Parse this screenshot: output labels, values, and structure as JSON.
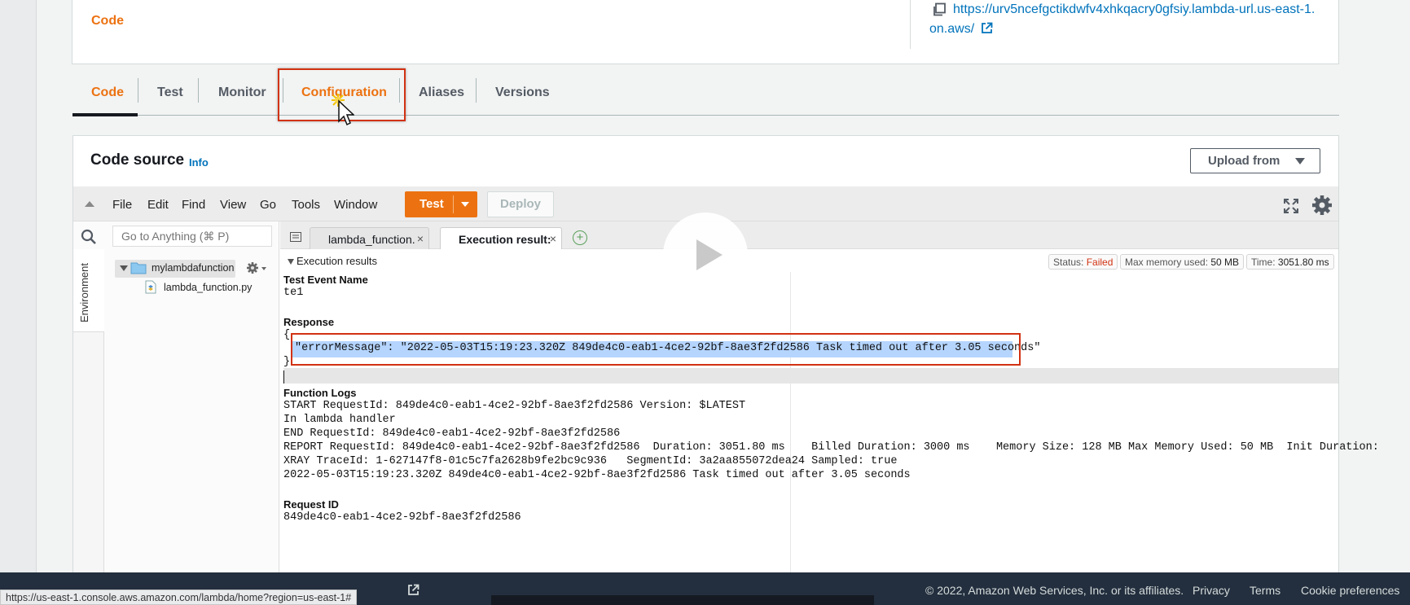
{
  "function_url": {
    "line1": "https://urv5ncefgctikdwfv4xhkqacry0gfsiy.lambda-url.us-east-1.",
    "line2": "on.aws/"
  },
  "tabs": [
    {
      "label": "Code",
      "active": true
    },
    {
      "label": "Test"
    },
    {
      "label": "Monitor"
    },
    {
      "label": "Configuration",
      "highlighted": true
    },
    {
      "label": "Aliases"
    },
    {
      "label": "Versions"
    }
  ],
  "code_source": {
    "title": "Code source",
    "info": "Info",
    "upload_from": "Upload from"
  },
  "ide": {
    "menu": [
      "File",
      "Edit",
      "Find",
      "View",
      "Go",
      "Tools",
      "Window"
    ],
    "test_label": "Test",
    "deploy_label": "Deploy",
    "search_placeholder": "Go to Anything (⌘ P)",
    "environment_label": "Environment",
    "folder": "mylambdafunction",
    "file": "lambda_function.py",
    "editor_tabs": [
      {
        "label": "lambda_function."
      },
      {
        "label": "Execution result:",
        "active": true
      }
    ]
  },
  "execution": {
    "header": "Execution results",
    "status_label": "Status:",
    "status_value": "Failed",
    "memory_label": "Max memory used:",
    "memory_value": "50 MB",
    "time_label": "Time:",
    "time_value": "3051.80 ms",
    "test_event_name_label": "Test Event Name",
    "test_event_name": "te1",
    "response_label": "Response",
    "response_open": "{",
    "response_line": "\"errorMessage\": \"2022-05-03T15:19:23.320Z 849de4c0-eab1-4ce2-92bf-8ae3f2fd2586 Task timed out after 3.05 seconds\"",
    "response_close": "}",
    "function_logs_label": "Function Logs",
    "logs": [
      "START RequestId: 849de4c0-eab1-4ce2-92bf-8ae3f2fd2586 Version: $LATEST",
      "In lambda handler",
      "END RequestId: 849de4c0-eab1-4ce2-92bf-8ae3f2fd2586",
      "REPORT RequestId: 849de4c0-eab1-4ce2-92bf-8ae3f2fd2586  Duration: 3051.80 ms    Billed Duration: 3000 ms    Memory Size: 128 MB Max Memory Used: 50 MB  Init Duration:",
      "XRAY TraceId: 1-627147f8-01c5c7fa2628b9fe2bc9c936   SegmentId: 3a2aa855072dea24 Sampled: true",
      "2022-05-03T15:19:23.320Z 849de4c0-eab1-4ce2-92bf-8ae3f2fd2586 Task timed out after 3.05 seconds"
    ],
    "request_id_label": "Request ID",
    "request_id": "849de4c0-eab1-4ce2-92bf-8ae3f2fd2586"
  },
  "footer": {
    "copyright": "© 2022, Amazon Web Services, Inc. or its affiliates.",
    "links": [
      "Privacy",
      "Terms",
      "Cookie preferences"
    ],
    "status_url": "https://us-east-1.console.aws.amazon.com/lambda/home?region=us-east-1#"
  },
  "colors": {
    "accent": "#ec7211",
    "link": "#0073bb",
    "highlight": "#d13212",
    "footer_bg": "#232f3e"
  }
}
